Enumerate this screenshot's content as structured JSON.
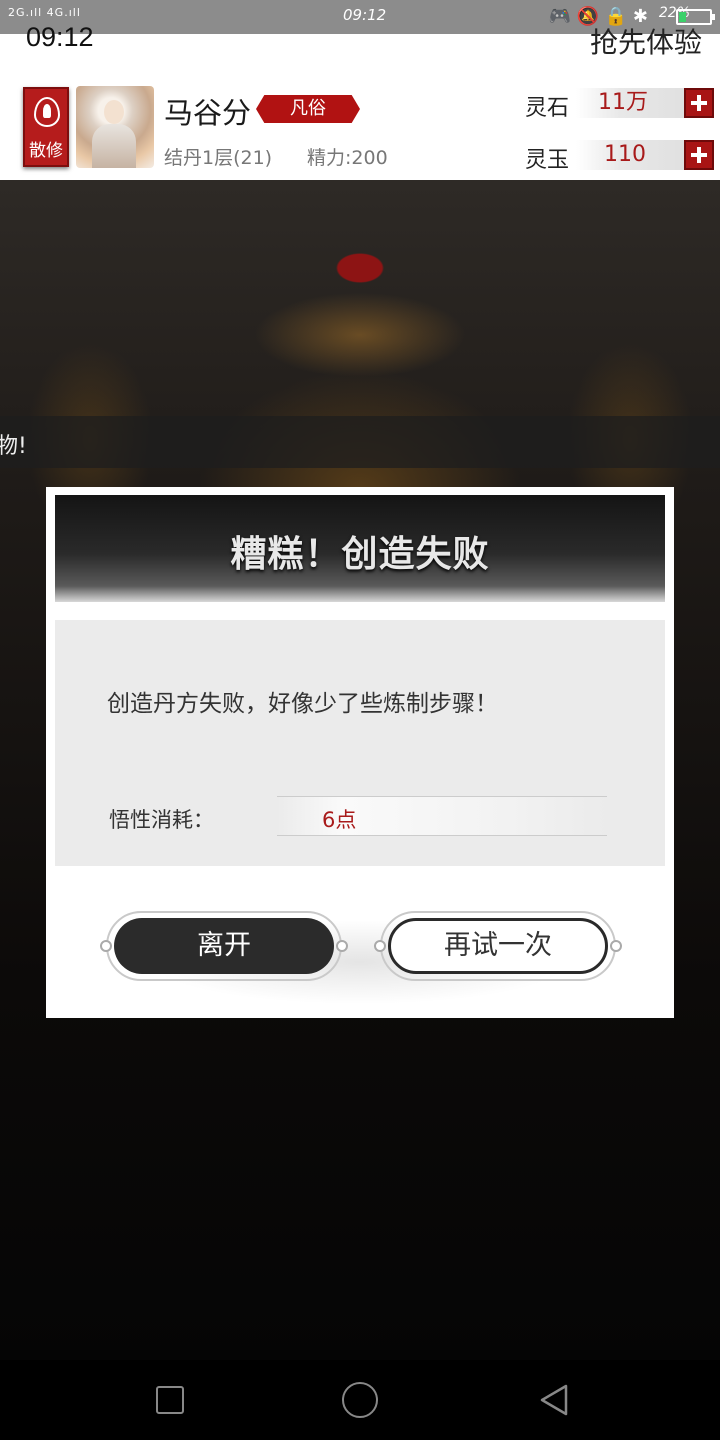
{
  "status_bar": {
    "signal": "2G.ıll 4G.ıll",
    "time_small": "09:12",
    "battery_percent": "22%",
    "battery_level": 0.22,
    "icons": [
      "gamepad-icon",
      "bell-off-icon",
      "lock-rotation-icon",
      "bluetooth-icon"
    ]
  },
  "header": {
    "clock": "09:12",
    "trial_label": "抢先体验",
    "sect_label": "散修",
    "player_name": "马谷分",
    "rank": "凡俗",
    "level": "结丹1层(21)",
    "stamina": "精力:200",
    "currencies": [
      {
        "label": "灵石",
        "value": "11万"
      },
      {
        "label": "灵玉",
        "value": "110"
      }
    ]
  },
  "scene": {
    "toast_fragment": "物!"
  },
  "dialog": {
    "title": "糟糕！创造失败",
    "message": "创造丹方失败，好像少了些炼制步骤！",
    "cost_label": "悟性消耗：",
    "cost_value": "6点",
    "leave_label": "离开",
    "retry_label": "再试一次"
  },
  "colors": {
    "accent_red": "#a81414",
    "dialog_bg": "#ebebeb"
  }
}
